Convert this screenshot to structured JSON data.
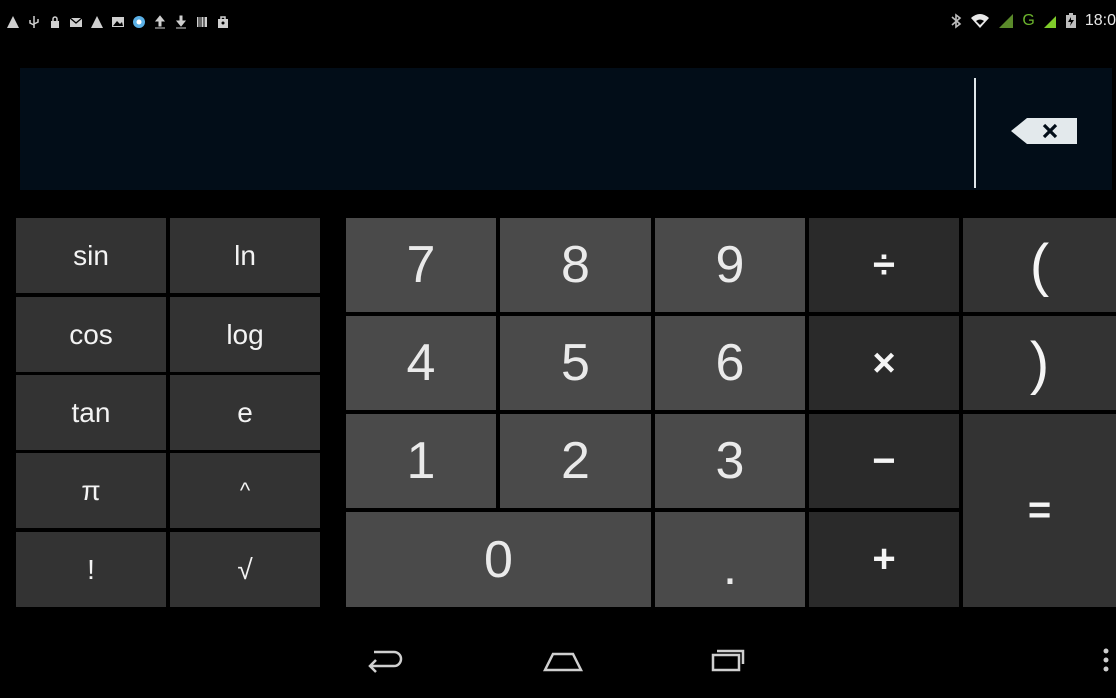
{
  "status_bar": {
    "time": "18:0",
    "left_icons": [
      "warning-icon",
      "usb-icon",
      "lock-icon",
      "gmail-icon",
      "warning-icon",
      "image-icon",
      "browser-icon",
      "upload-icon",
      "download-icon",
      "barcode-icon",
      "shop-bag-icon"
    ],
    "right_icons": [
      "bluetooth-icon",
      "wifi-icon",
      "signal-icon",
      "network-type-icon",
      "battery-icon"
    ],
    "network_type": "G"
  },
  "display": {
    "expression": "",
    "backspace_icon": "backspace-icon"
  },
  "advanced_pad": {
    "keys": [
      [
        "sin",
        "ln"
      ],
      [
        "cos",
        "log"
      ],
      [
        "tan",
        "e"
      ],
      [
        "π",
        "^"
      ],
      [
        "!",
        "√"
      ]
    ]
  },
  "number_pad": {
    "row1": [
      "7",
      "8",
      "9"
    ],
    "row2": [
      "4",
      "5",
      "6"
    ],
    "row3": [
      "1",
      "2",
      "3"
    ],
    "zero": "0",
    "dot": "."
  },
  "operators": {
    "divide": "÷",
    "multiply": "×",
    "minus": "−",
    "plus": "+",
    "open_paren": "(",
    "close_paren": ")",
    "equals": "="
  },
  "nav_bar": {
    "buttons": [
      "back-icon",
      "home-icon",
      "recents-icon",
      "overflow-menu-icon"
    ]
  },
  "colors": {
    "display_bg": "#020d18",
    "number_key_bg": "#4a4a4a",
    "advanced_key_bg": "#333333",
    "operator_key_bg": "#2a2a2a"
  }
}
